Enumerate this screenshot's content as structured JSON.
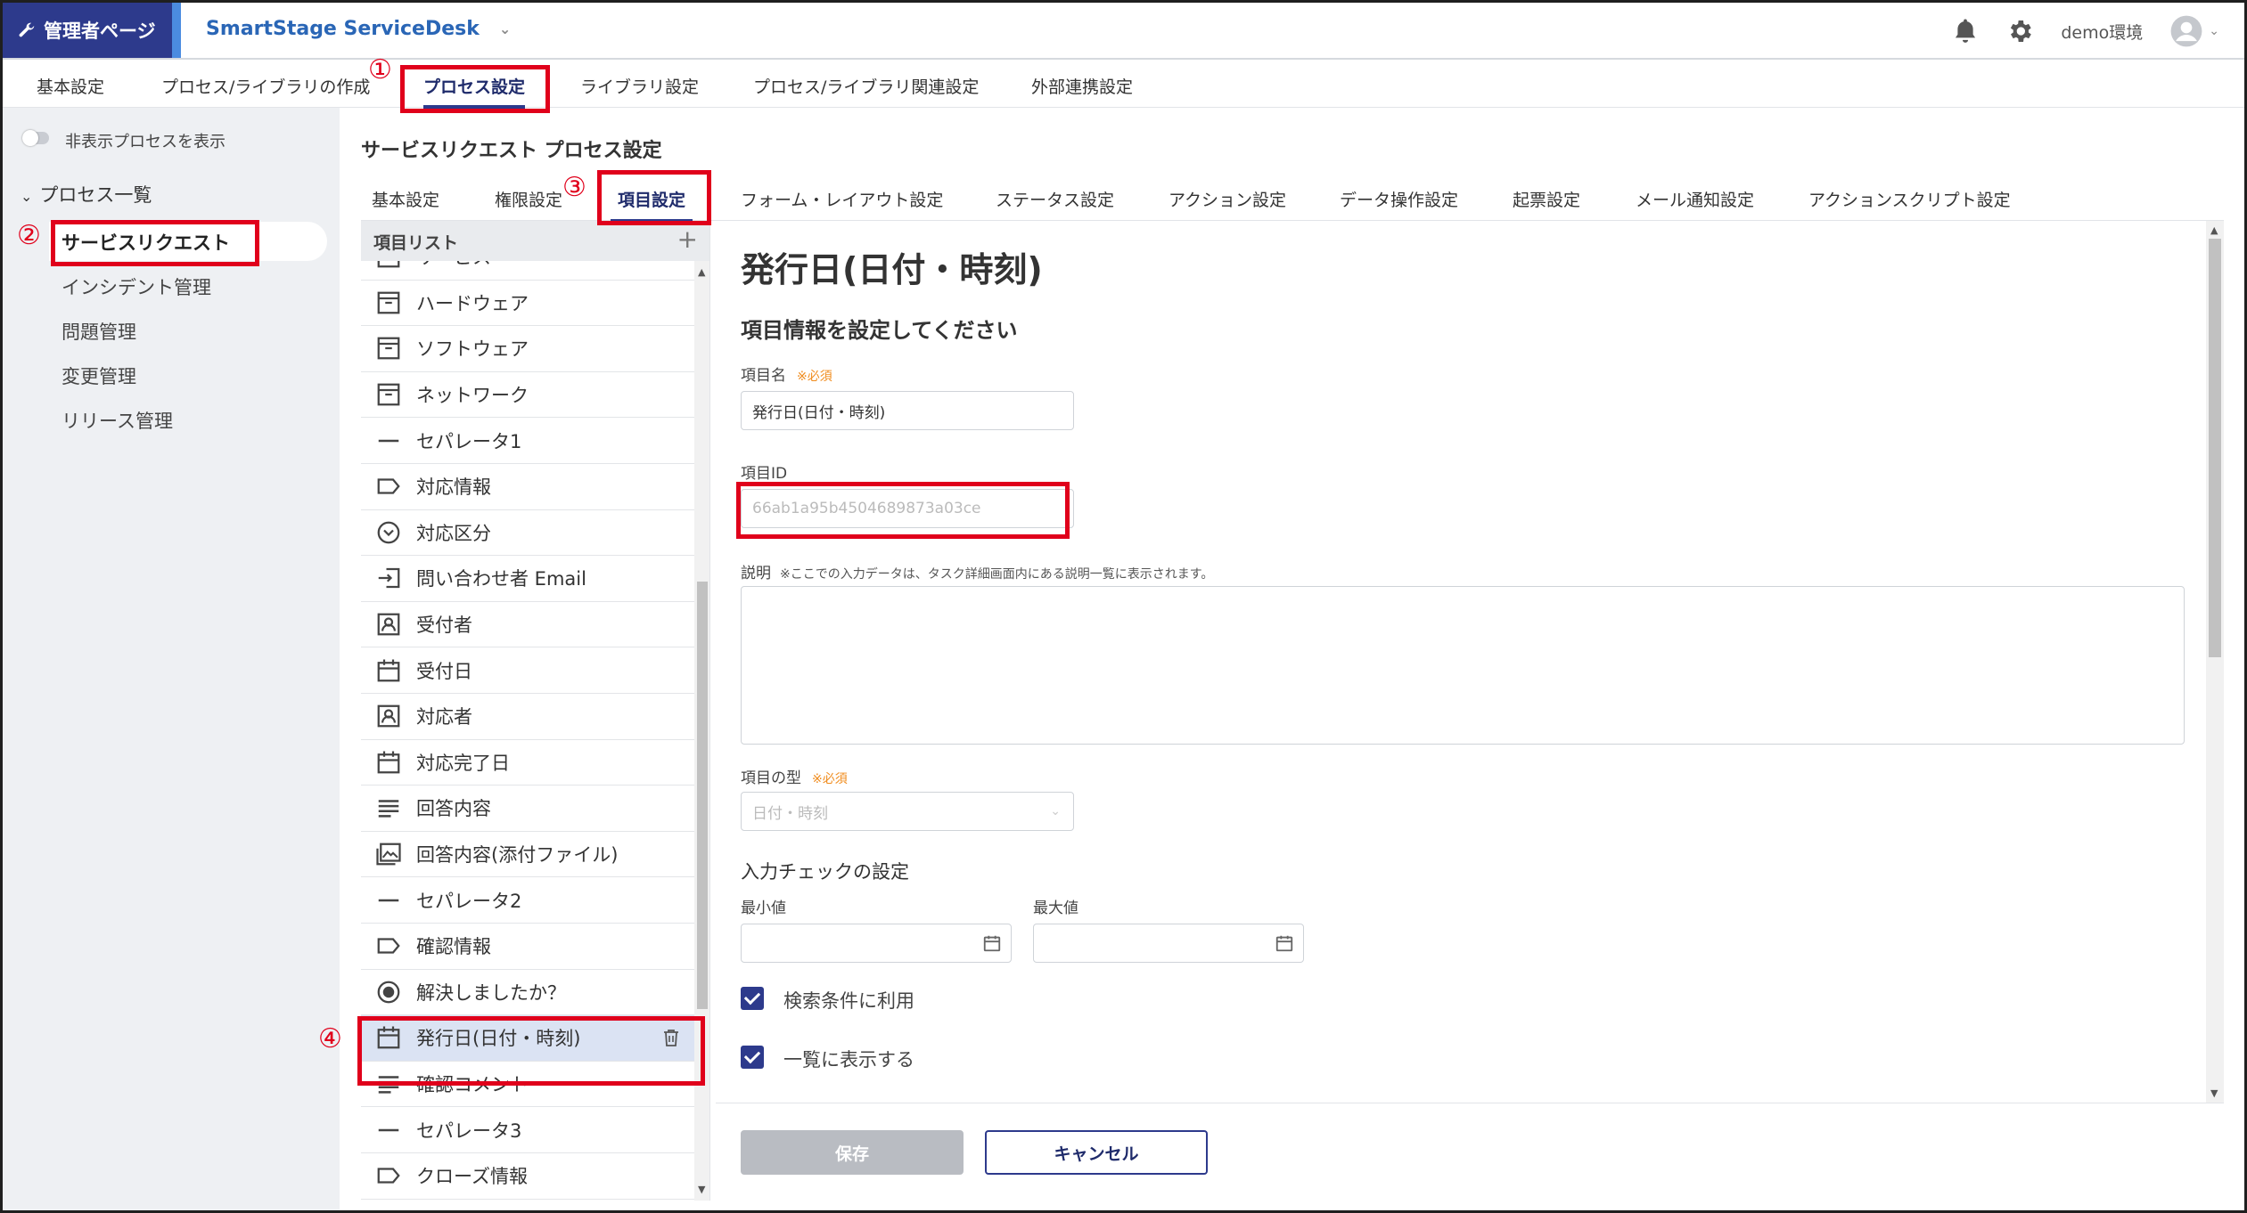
{
  "header": {
    "admin_label": "管理者ページ",
    "app_name": "SmartStage ServiceDesk",
    "env_label": "demo環境"
  },
  "top_nav": {
    "items": [
      "基本設定",
      "プロセス/ライブラリの作成",
      "プロセス設定",
      "ライブラリ設定",
      "プロセス/ライブラリ関連設定",
      "外部連携設定"
    ],
    "active": "プロセス設定"
  },
  "sidebar": {
    "toggle_label": "非表示プロセスを表示",
    "section_label": "プロセス一覧",
    "items": [
      "サービスリクエスト",
      "インシデント管理",
      "問題管理",
      "変更管理",
      "リリース管理"
    ],
    "selected": "サービスリクエスト"
  },
  "main": {
    "title": "サービスリクエスト プロセス設定",
    "tabs": [
      "基本設定",
      "権限設定",
      "項目設定",
      "フォーム・レイアウト設定",
      "ステータス設定",
      "アクション設定",
      "データ操作設定",
      "起票設定",
      "メール通知設定",
      "アクションスクリプト設定"
    ],
    "active_tab": "項目設定"
  },
  "item_list": {
    "header": "項目リスト",
    "add_symbol": "+",
    "items": [
      {
        "label": "サービス",
        "icon": "box-icon"
      },
      {
        "label": "ハードウェア",
        "icon": "box-icon"
      },
      {
        "label": "ソフトウェア",
        "icon": "box-icon"
      },
      {
        "label": "ネットワーク",
        "icon": "box-icon"
      },
      {
        "label": "セパレータ1",
        "icon": "separator-icon"
      },
      {
        "label": "対応情報",
        "icon": "tag-icon"
      },
      {
        "label": "対応区分",
        "icon": "dropdown-circle-icon"
      },
      {
        "label": "問い合わせ者 Email",
        "icon": "input-arrow-icon"
      },
      {
        "label": "受付者",
        "icon": "person-icon"
      },
      {
        "label": "受付日",
        "icon": "calendar-icon"
      },
      {
        "label": "対応者",
        "icon": "person-icon"
      },
      {
        "label": "対応完了日",
        "icon": "calendar-icon"
      },
      {
        "label": "回答内容",
        "icon": "text-lines-icon"
      },
      {
        "label": "回答内容(添付ファイル)",
        "icon": "image-icon"
      },
      {
        "label": "セパレータ2",
        "icon": "separator-icon"
      },
      {
        "label": "確認情報",
        "icon": "tag-icon"
      },
      {
        "label": "解決しましたか？",
        "icon": "radio-icon"
      },
      {
        "label": "発行日(日付・時刻)",
        "icon": "calendar-icon"
      },
      {
        "label": "確認コメント",
        "icon": "text-lines-icon"
      },
      {
        "label": "セパレータ3",
        "icon": "separator-icon"
      },
      {
        "label": "クローズ情報",
        "icon": "tag-icon"
      }
    ],
    "selected": "発行日(日付・時刻)"
  },
  "detail": {
    "title": "発行日(日付・時刻)",
    "subtitle": "項目情報を設定してください",
    "name_label": "項目名",
    "required_mark": "※必須",
    "name_value": "発行日(日付・時刻)",
    "id_label": "項目ID",
    "id_value": "66ab1a95b4504689873a03ce",
    "desc_label": "説明",
    "desc_note": "※ここでの入力データは、タスク詳細画面内にある説明一覧に表示されます。",
    "desc_value": "",
    "type_label": "項目の型",
    "type_value": "日付・時刻",
    "check_section": "入力チェックの設定",
    "min_label": "最小値",
    "max_label": "最大値",
    "min_value": "",
    "max_value": "",
    "search_label": "検索条件に利用",
    "search_checked": true,
    "list_label": "一覧に表示する",
    "list_checked": true
  },
  "footer": {
    "save_label": "保存",
    "cancel_label": "キャンセル"
  },
  "callouts": [
    "①",
    "②",
    "③",
    "④"
  ],
  "colors": {
    "brand": "#2d3a8c",
    "accent": "#4b8be0",
    "callout": "#e0001b",
    "required": "#f08c1e"
  }
}
